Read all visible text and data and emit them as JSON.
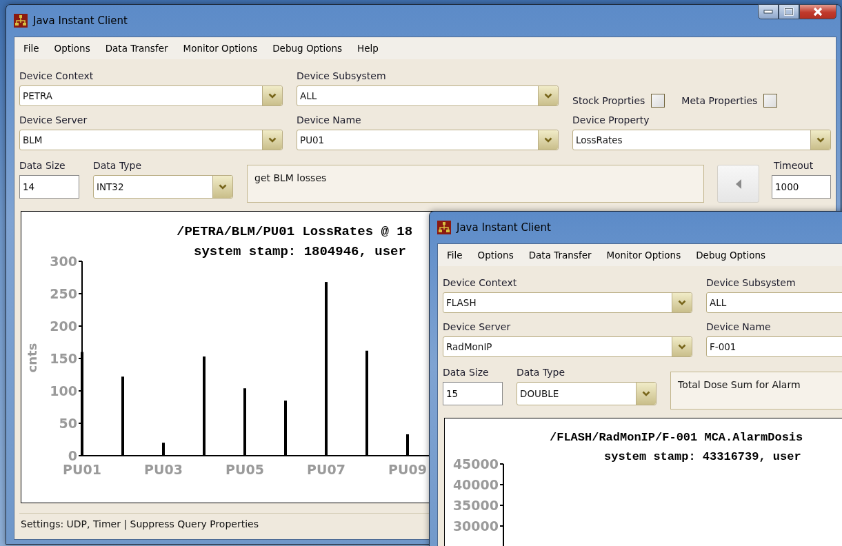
{
  "windows": [
    {
      "title": "Java Instant Client",
      "caption_buttons": true,
      "menu": [
        "File",
        "Options",
        "Data Transfer",
        "Monitor Options",
        "Debug Options",
        "Help"
      ],
      "fields": [
        {
          "label": "Device Context",
          "value": "PETRA"
        },
        {
          "label": "Device Subsystem",
          "value": "ALL"
        },
        {
          "label": "Device Server",
          "value": "BLM"
        },
        {
          "label": "Device Name",
          "value": "PU01"
        },
        {
          "label": "Device Property",
          "value": "LossRates"
        }
      ],
      "options": [
        {
          "label": "Stock Proprties",
          "checked": false
        },
        {
          "label": "Meta Properties",
          "checked": false
        }
      ],
      "data_size": {
        "label": "Data Size",
        "value": "14"
      },
      "data_type": {
        "label": "Data Type",
        "value": "INT32"
      },
      "description": "get BLM losses",
      "timeout": {
        "label": "Timeout",
        "value": "1000"
      },
      "chart_data": {
        "type": "bar",
        "title": "/PETRA/BLM/PU01 LossRates @ 18",
        "subtitle": "system stamp: 1804946, user",
        "ylabel": "cnts",
        "categories": [
          "PU01",
          null,
          "PU03",
          null,
          "PU05",
          null,
          "PU07",
          null,
          "PU09"
        ],
        "values": [
          160,
          122,
          20,
          153,
          104,
          85,
          268,
          162,
          33
        ],
        "ylim": [
          0,
          300
        ],
        "yticks": [
          0,
          50,
          100,
          150,
          200,
          250,
          300
        ]
      },
      "status_bar": "Settings: UDP, Timer | Suppress Query Properties"
    },
    {
      "title": "Java Instant Client",
      "menu": [
        "File",
        "Options",
        "Data Transfer",
        "Monitor Options",
        "Debug Options"
      ],
      "fields": [
        {
          "label": "Device Context",
          "value": "FLASH"
        },
        {
          "label": "Device Subsystem",
          "value": "ALL"
        },
        {
          "label": "Device Server",
          "value": "RadMonIP"
        },
        {
          "label": "Device Name",
          "value": "F-001"
        }
      ],
      "data_size": {
        "label": "Data Size",
        "value": "15"
      },
      "data_type": {
        "label": "Data Type",
        "value": "DOUBLE"
      },
      "description": "Total Dose Sum for Alarm",
      "chart": {
        "title": "/FLASH/RadMonIP/F-001 MCA.AlarmDosis",
        "subtitle": "system stamp: 43316739, user",
        "y_tick_labels": [
          "45000",
          "40000",
          "35000",
          "30000"
        ]
      }
    }
  ]
}
